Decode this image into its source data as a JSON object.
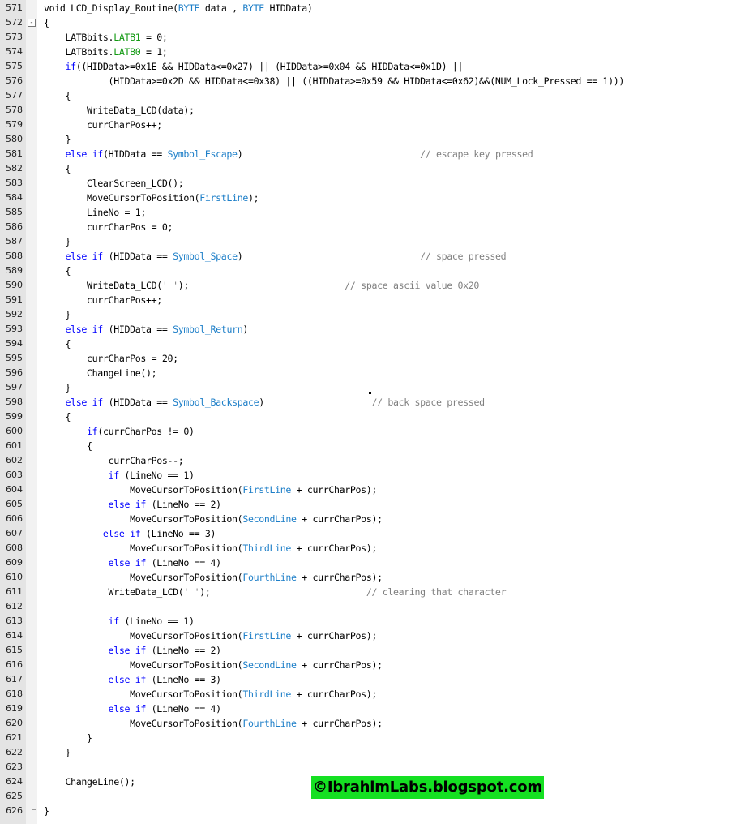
{
  "editor": {
    "lines": [
      {
        "n": "571",
        "t": [
          [
            "n",
            "void "
          ],
          [
            "n",
            "LCD_Display_Routine("
          ],
          [
            "t",
            "BYTE"
          ],
          [
            "n",
            " data , "
          ],
          [
            "t",
            "BYTE"
          ],
          [
            "n",
            " HIDData)"
          ]
        ]
      },
      {
        "n": "572",
        "fold": "-",
        "t": [
          [
            "n",
            "{"
          ]
        ]
      },
      {
        "n": "573",
        "t": [
          [
            "n",
            "    LATBbits."
          ],
          [
            "g",
            "LATB1"
          ],
          [
            "n",
            " = 0;"
          ]
        ]
      },
      {
        "n": "574",
        "t": [
          [
            "n",
            "    LATBbits."
          ],
          [
            "g",
            "LATB0"
          ],
          [
            "n",
            " = 1;"
          ]
        ]
      },
      {
        "n": "575",
        "t": [
          [
            "k",
            "    if"
          ],
          [
            "n",
            "((HIDData>=0x1E && HIDData<=0x27) || (HIDData>=0x04 && HIDData<=0x1D) ||"
          ]
        ]
      },
      {
        "n": "576",
        "t": [
          [
            "n",
            "            (HIDData>=0x2D && HIDData<=0x38) || ((HIDData>=0x59 && HIDData<=0x62)&&(NUM_Lock_Pressed == 1)))"
          ]
        ]
      },
      {
        "n": "577",
        "t": [
          [
            "n",
            "    {"
          ]
        ]
      },
      {
        "n": "578",
        "t": [
          [
            "n",
            "        WriteData_LCD(data);"
          ]
        ]
      },
      {
        "n": "579",
        "t": [
          [
            "n",
            "        currCharPos++;"
          ]
        ]
      },
      {
        "n": "580",
        "t": [
          [
            "n",
            "    }"
          ]
        ]
      },
      {
        "n": "581",
        "t": [
          [
            "k",
            "    else if"
          ],
          [
            "n",
            "(HIDData == "
          ],
          [
            "t",
            "Symbol_Escape"
          ],
          [
            "n",
            ")                                 "
          ],
          [
            "c",
            "// escape key pressed"
          ]
        ]
      },
      {
        "n": "582",
        "t": [
          [
            "n",
            "    {"
          ]
        ]
      },
      {
        "n": "583",
        "t": [
          [
            "n",
            "        ClearScreen_LCD();"
          ]
        ]
      },
      {
        "n": "584",
        "t": [
          [
            "n",
            "        MoveCursorToPosition("
          ],
          [
            "t",
            "FirstLine"
          ],
          [
            "n",
            ");"
          ]
        ]
      },
      {
        "n": "585",
        "t": [
          [
            "n",
            "        LineNo = 1;"
          ]
        ]
      },
      {
        "n": "586",
        "t": [
          [
            "n",
            "        currCharPos = 0;"
          ]
        ]
      },
      {
        "n": "587",
        "t": [
          [
            "n",
            "    }"
          ]
        ]
      },
      {
        "n": "588",
        "t": [
          [
            "k",
            "    else if"
          ],
          [
            "n",
            " (HIDData == "
          ],
          [
            "t",
            "Symbol_Space"
          ],
          [
            "n",
            ")                                 "
          ],
          [
            "c",
            "// space pressed"
          ]
        ]
      },
      {
        "n": "589",
        "t": [
          [
            "n",
            "    {"
          ]
        ]
      },
      {
        "n": "590",
        "t": [
          [
            "n",
            "        WriteData_LCD("
          ],
          [
            "c",
            "' '"
          ],
          [
            "n",
            ");                             "
          ],
          [
            "c",
            "// space ascii value 0x20"
          ]
        ]
      },
      {
        "n": "591",
        "t": [
          [
            "n",
            "        currCharPos++;"
          ]
        ]
      },
      {
        "n": "592",
        "t": [
          [
            "n",
            "    }"
          ]
        ]
      },
      {
        "n": "593",
        "t": [
          [
            "k",
            "    else if"
          ],
          [
            "n",
            " (HIDData == "
          ],
          [
            "t",
            "Symbol_Return"
          ],
          [
            "n",
            ")"
          ]
        ]
      },
      {
        "n": "594",
        "t": [
          [
            "n",
            "    {"
          ]
        ]
      },
      {
        "n": "595",
        "t": [
          [
            "n",
            "        currCharPos = 20;"
          ]
        ]
      },
      {
        "n": "596",
        "t": [
          [
            "n",
            "        ChangeLine();"
          ]
        ]
      },
      {
        "n": "597",
        "t": [
          [
            "n",
            "    }"
          ]
        ]
      },
      {
        "n": "598",
        "t": [
          [
            "k",
            "    else if"
          ],
          [
            "n",
            " (HIDData == "
          ],
          [
            "t",
            "Symbol_Backspace"
          ],
          [
            "n",
            ")                    "
          ],
          [
            "c",
            "// back space pressed"
          ]
        ]
      },
      {
        "n": "599",
        "t": [
          [
            "n",
            "    {"
          ]
        ]
      },
      {
        "n": "600",
        "t": [
          [
            "k",
            "        if"
          ],
          [
            "n",
            "(currCharPos != 0)"
          ]
        ]
      },
      {
        "n": "601",
        "t": [
          [
            "n",
            "        {"
          ]
        ]
      },
      {
        "n": "602",
        "t": [
          [
            "n",
            "            currCharPos--;"
          ]
        ]
      },
      {
        "n": "603",
        "t": [
          [
            "k",
            "            if"
          ],
          [
            "n",
            " (LineNo == 1)"
          ]
        ]
      },
      {
        "n": "604",
        "t": [
          [
            "n",
            "                MoveCursorToPosition("
          ],
          [
            "t",
            "FirstLine"
          ],
          [
            "n",
            " + currCharPos);"
          ]
        ]
      },
      {
        "n": "605",
        "t": [
          [
            "k",
            "            else if"
          ],
          [
            "n",
            " (LineNo == 2)"
          ]
        ]
      },
      {
        "n": "606",
        "t": [
          [
            "n",
            "                MoveCursorToPosition("
          ],
          [
            "t",
            "SecondLine"
          ],
          [
            "n",
            " + currCharPos);"
          ]
        ]
      },
      {
        "n": "607",
        "t": [
          [
            "k",
            "           else if"
          ],
          [
            "n",
            " (LineNo == 3)"
          ]
        ]
      },
      {
        "n": "608",
        "t": [
          [
            "n",
            "                MoveCursorToPosition("
          ],
          [
            "t",
            "ThirdLine"
          ],
          [
            "n",
            " + currCharPos);"
          ]
        ]
      },
      {
        "n": "609",
        "t": [
          [
            "k",
            "            else if"
          ],
          [
            "n",
            " (LineNo == 4)"
          ]
        ]
      },
      {
        "n": "610",
        "t": [
          [
            "n",
            "                MoveCursorToPosition("
          ],
          [
            "t",
            "FourthLine"
          ],
          [
            "n",
            " + currCharPos);"
          ]
        ]
      },
      {
        "n": "611",
        "t": [
          [
            "n",
            "            WriteData_LCD("
          ],
          [
            "c",
            "' '"
          ],
          [
            "n",
            ");                             "
          ],
          [
            "c",
            "// clearing that character"
          ]
        ]
      },
      {
        "n": "612",
        "t": []
      },
      {
        "n": "613",
        "t": [
          [
            "k",
            "            if"
          ],
          [
            "n",
            " (LineNo == 1)"
          ]
        ]
      },
      {
        "n": "614",
        "t": [
          [
            "n",
            "                MoveCursorToPosition("
          ],
          [
            "t",
            "FirstLine"
          ],
          [
            "n",
            " + currCharPos);"
          ]
        ]
      },
      {
        "n": "615",
        "t": [
          [
            "k",
            "            else if"
          ],
          [
            "n",
            " (LineNo == 2)"
          ]
        ]
      },
      {
        "n": "616",
        "t": [
          [
            "n",
            "                MoveCursorToPosition("
          ],
          [
            "t",
            "SecondLine"
          ],
          [
            "n",
            " + currCharPos);"
          ]
        ]
      },
      {
        "n": "617",
        "t": [
          [
            "k",
            "            else if"
          ],
          [
            "n",
            " (LineNo == 3)"
          ]
        ]
      },
      {
        "n": "618",
        "t": [
          [
            "n",
            "                MoveCursorToPosition("
          ],
          [
            "t",
            "ThirdLine"
          ],
          [
            "n",
            " + currCharPos);"
          ]
        ]
      },
      {
        "n": "619",
        "t": [
          [
            "k",
            "            else if"
          ],
          [
            "n",
            " (LineNo == 4)"
          ]
        ]
      },
      {
        "n": "620",
        "t": [
          [
            "n",
            "                MoveCursorToPosition("
          ],
          [
            "t",
            "FourthLine"
          ],
          [
            "n",
            " + currCharPos);"
          ]
        ]
      },
      {
        "n": "621",
        "t": [
          [
            "n",
            "        }"
          ]
        ]
      },
      {
        "n": "622",
        "t": [
          [
            "n",
            "    }"
          ]
        ]
      },
      {
        "n": "623",
        "t": []
      },
      {
        "n": "624",
        "t": [
          [
            "n",
            "    ChangeLine();"
          ]
        ]
      },
      {
        "n": "625",
        "t": []
      },
      {
        "n": "626",
        "t": [
          [
            "n",
            "}"
          ]
        ]
      }
    ]
  },
  "watermark": {
    "text": "©IbrahimLabs.blogspot.com"
  },
  "colors": {
    "keyword": "#0000ff",
    "type": "#1e7fc8",
    "comment": "#808080",
    "register": "#119911",
    "watermark_bg": "#15e022"
  }
}
